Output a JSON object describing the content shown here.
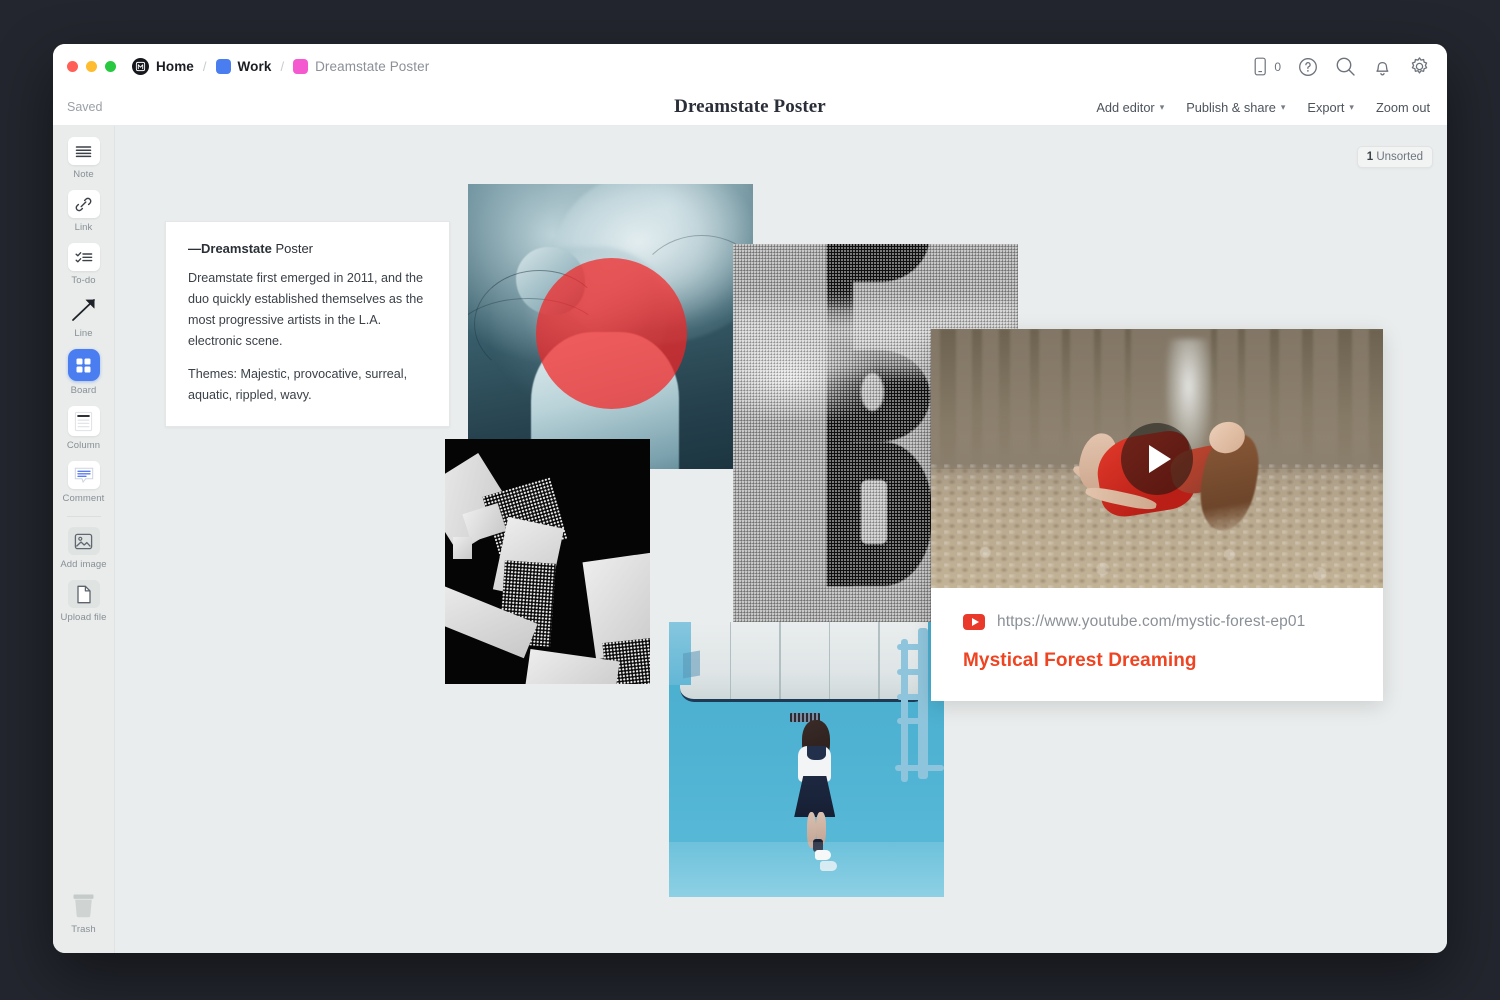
{
  "window": {
    "traffic_lights": [
      "close",
      "minimize",
      "maximize"
    ]
  },
  "breadcrumb": {
    "items": [
      {
        "label": "Home",
        "icon": "app-logo-icon",
        "swatch_color": "#16181d",
        "active": true
      },
      {
        "label": "Work",
        "icon": "color-swatch-icon",
        "swatch_color": "#4a7df0",
        "active": true
      },
      {
        "label": "Dreamstate Poster",
        "icon": "color-swatch-icon",
        "swatch_color": "#f459d0",
        "active": false
      }
    ],
    "separator": "/"
  },
  "titlebar_actions": [
    {
      "name": "mobile-preview-icon",
      "label": "0"
    },
    {
      "name": "help-icon",
      "label": "?"
    },
    {
      "name": "search-icon",
      "label": ""
    },
    {
      "name": "notifications-bell-icon",
      "label": ""
    },
    {
      "name": "settings-gear-icon",
      "label": ""
    }
  ],
  "subbar": {
    "save_status": "Saved",
    "document_title": "Dreamstate Poster",
    "actions": [
      {
        "label": "Add editor",
        "has_caret": true
      },
      {
        "label": "Publish & share",
        "has_caret": true
      },
      {
        "label": "Export",
        "has_caret": true
      },
      {
        "label": "Zoom out",
        "has_caret": false
      }
    ],
    "caret_glyph": "▾"
  },
  "sidebar": {
    "tools": [
      {
        "label": "Note",
        "icon": "note-lines-icon",
        "active": false
      },
      {
        "label": "Link",
        "icon": "link-chain-icon",
        "active": false
      },
      {
        "label": "To-do",
        "icon": "checklist-icon",
        "active": false
      },
      {
        "label": "Line",
        "icon": "arrow-line-icon",
        "active": false
      },
      {
        "label": "Board",
        "icon": "board-grid-icon",
        "active": true
      },
      {
        "label": "Column",
        "icon": "column-layout-icon",
        "active": false
      },
      {
        "label": "Comment",
        "icon": "comment-bubble-icon",
        "active": false
      },
      {
        "label": "Add image",
        "icon": "image-picture-icon",
        "active": false
      },
      {
        "label": "Upload file",
        "icon": "file-document-icon",
        "active": false
      }
    ],
    "trash": {
      "label": "Trash",
      "icon": "trash-can-icon"
    }
  },
  "canvas": {
    "unsorted_badge": {
      "count": "1",
      "label": "Unsorted"
    },
    "note_card": {
      "heading_bold": "—Dreamstate",
      "heading_rest": " Poster",
      "paragraphs": [
        "Dreamstate first emerged in 2011, and the duo quickly established themselves as the most progressive artists in the L.A. electronic scene.",
        "Themes: Majestic, provocative, surreal, aquatic, rippled, wavy."
      ]
    },
    "media": [
      {
        "name": "image-teal-portrait-red-circle",
        "alt": "Teal toned portrait with flowing hair and red circle overlay"
      },
      {
        "name": "image-halftone-letterform",
        "alt": "Grayscale halftone letterform with water reflection"
      },
      {
        "name": "image-abstract-black-white",
        "alt": "Black and white abstract halftone geometric shapes"
      },
      {
        "name": "image-underwater-pool",
        "alt": "Figure floating in a blue swimming pool"
      }
    ],
    "video_card": {
      "url": "https://www.youtube.com/mystic-forest-ep01",
      "title": "Mystical Forest Dreaming",
      "provider_icon": "youtube-icon",
      "play_icon": "play-button-icon",
      "thumbnail_alt": "Woman in red dress levitating in a forest"
    }
  },
  "colors": {
    "accent_blue": "#4a7df0",
    "accent_pink": "#f459d0",
    "youtube_red": "#e8392a",
    "link_title": "#ef4422",
    "canvas_bg": "#eaeded",
    "sidebar_bg": "#e9eceb"
  }
}
